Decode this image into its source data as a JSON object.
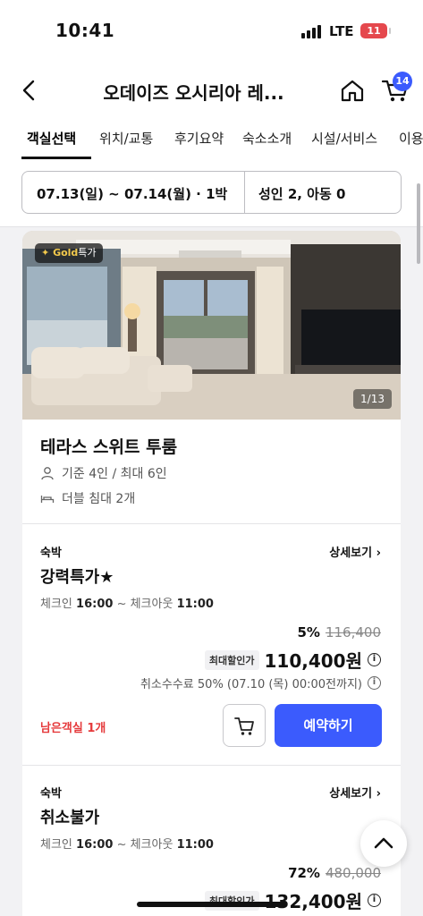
{
  "status_bar": {
    "time": "10:41",
    "network": "LTE",
    "battery": "11"
  },
  "header": {
    "title": "오데이즈 오시리아 레...",
    "cart_count": "14"
  },
  "tabs": [
    {
      "label": "객실선택",
      "active": true
    },
    {
      "label": "위치/교통"
    },
    {
      "label": "후기요약"
    },
    {
      "label": "숙소소개"
    },
    {
      "label": "시설/서비스"
    },
    {
      "label": "이용"
    }
  ],
  "booking": {
    "dates": "07.13(일) ~ 07.14(월) · 1박",
    "guests": "성인 2, 아동 0"
  },
  "room": {
    "badge_main": "Gold",
    "badge_suffix": "특가",
    "photo_counter": "1/13",
    "name": "테라스 스위트 투룸",
    "capacity": "기준 4인 / 최대 6인",
    "bed": "더블 침대 2개"
  },
  "plans": [
    {
      "kind": "숙박",
      "detail": "상세보기",
      "name": "강력특가★",
      "checkin_label": "체크인",
      "checkin": "16:00",
      "checkout_label": "~ 체크아웃",
      "checkout": "11:00",
      "discount": "5%",
      "original_price": "116,400",
      "max_label": "최대할인가",
      "price": "110,400원",
      "cancel_fee": "취소수수료 50% (07.10 (목) 00:00전까지)",
      "rooms_left": "남은객실 1개",
      "reserve": "예약하기"
    },
    {
      "kind": "숙박",
      "detail": "상세보기",
      "name": "취소불가",
      "checkin_label": "체크인",
      "checkin": "16:00",
      "checkout_label": "~ 체크아웃",
      "checkout": "11:00",
      "discount": "72%",
      "original_price": "480,000",
      "max_label": "최대할인가",
      "price": "132,400원"
    }
  ],
  "colors": {
    "accent": "#3b5bfd",
    "alert": "#e5393b",
    "gold": "#f2c94c"
  }
}
